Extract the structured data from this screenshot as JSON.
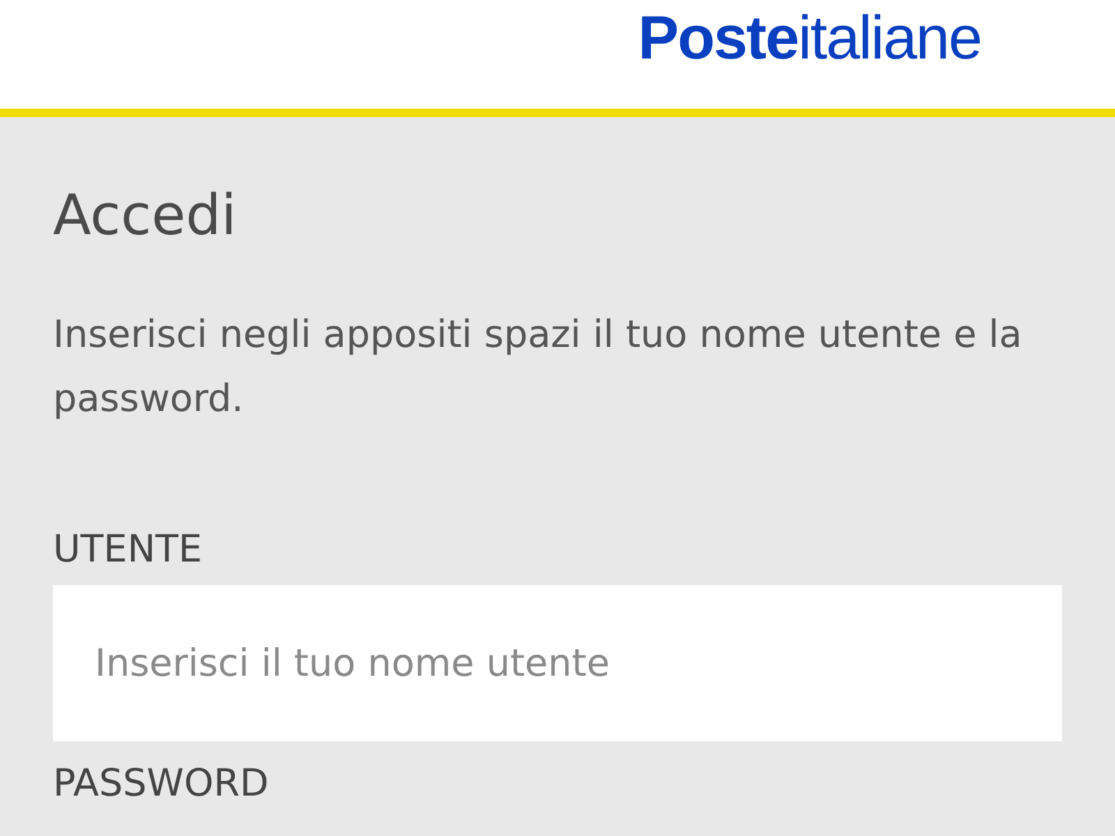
{
  "header": {
    "logo": "**Poste**italiane"
  },
  "login": {
    "title": "Accedi",
    "instructions": "Inserisci negli appositi spazi il tuo nome utente e la password.",
    "fields": [
      {
        "label": "UTENTE",
        "placeholder": "Inserisci il tuo nome utente"
      }
    ],
    "next_label": "PASSWORD"
  }
}
